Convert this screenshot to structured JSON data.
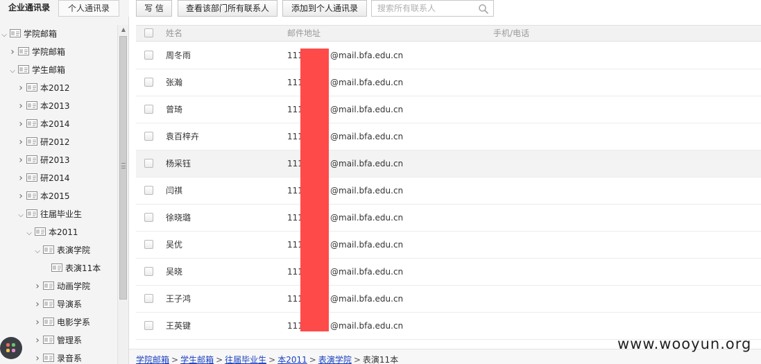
{
  "sidebar": {
    "tabs": [
      {
        "label": "企业通讯录",
        "active": true
      },
      {
        "label": "个人通讯录",
        "active": false
      }
    ],
    "tree": [
      {
        "label": "学院邮箱",
        "level": 0,
        "chevron": "expanded"
      },
      {
        "label": "学院邮箱",
        "level": 1,
        "chevron": "collapsed"
      },
      {
        "label": "学生邮箱",
        "level": 1,
        "chevron": "expanded"
      },
      {
        "label": "本2012",
        "level": 2,
        "chevron": "collapsed"
      },
      {
        "label": "本2013",
        "level": 2,
        "chevron": "collapsed"
      },
      {
        "label": "本2014",
        "level": 2,
        "chevron": "collapsed"
      },
      {
        "label": "研2012",
        "level": 2,
        "chevron": "collapsed"
      },
      {
        "label": "研2013",
        "level": 2,
        "chevron": "collapsed"
      },
      {
        "label": "研2014",
        "level": 2,
        "chevron": "collapsed"
      },
      {
        "label": "本2015",
        "level": 2,
        "chevron": "collapsed"
      },
      {
        "label": "往届毕业生",
        "level": 2,
        "chevron": "expanded"
      },
      {
        "label": "本2011",
        "level": 3,
        "chevron": "expanded"
      },
      {
        "label": "表演学院",
        "level": 4,
        "chevron": "expanded"
      },
      {
        "label": "表演11本",
        "level": 5,
        "chevron": "none"
      },
      {
        "label": "动画学院",
        "level": 4,
        "chevron": "collapsed"
      },
      {
        "label": "导演系",
        "level": 4,
        "chevron": "collapsed"
      },
      {
        "label": "电影学系",
        "level": 4,
        "chevron": "collapsed"
      },
      {
        "label": "管理系",
        "level": 4,
        "chevron": "collapsed"
      },
      {
        "label": "录音系",
        "level": 4,
        "chevron": "collapsed"
      }
    ]
  },
  "toolbar": {
    "write_label": "写 信",
    "view_all_label": "查看该部门所有联系人",
    "add_personal_label": "添加到个人通讯录",
    "search_placeholder": "搜索所有联系人"
  },
  "table": {
    "headers": {
      "name": "姓名",
      "email": "邮件地址",
      "phone": "手机/电话"
    },
    "rows": [
      {
        "name": "周冬雨",
        "email_prefix": "111",
        "email_domain": "@mail.bfa.edu.cn",
        "phone": ""
      },
      {
        "name": "张瀚",
        "email_prefix": "111",
        "email_domain": "@mail.bfa.edu.cn",
        "phone": ""
      },
      {
        "name": "曾琦",
        "email_prefix": "111",
        "email_domain": "@mail.bfa.edu.cn",
        "phone": ""
      },
      {
        "name": "袁百梓卉",
        "email_prefix": "111",
        "email_domain": "@mail.bfa.edu.cn",
        "phone": ""
      },
      {
        "name": "杨采钰",
        "email_prefix": "111",
        "email_domain": "@mail.bfa.edu.cn",
        "phone": "",
        "hover": true
      },
      {
        "name": "闫祺",
        "email_prefix": "111",
        "email_domain": "@mail.bfa.edu.cn",
        "phone": ""
      },
      {
        "name": "徐晓璐",
        "email_prefix": "111",
        "email_domain": "@mail.bfa.edu.cn",
        "phone": ""
      },
      {
        "name": "吴优",
        "email_prefix": "111",
        "email_domain": "@mail.bfa.edu.cn",
        "phone": ""
      },
      {
        "name": "吴晓",
        "email_prefix": "111",
        "email_domain": "@mail.bfa.edu.cn",
        "phone": ""
      },
      {
        "name": "王子鸿",
        "email_prefix": "111",
        "email_domain": "@mail.bfa.edu.cn",
        "phone": ""
      },
      {
        "name": "王英键",
        "email_prefix": "111",
        "email_domain": "@mail.bfa.edu.cn",
        "phone": ""
      }
    ]
  },
  "breadcrumb": {
    "links": [
      "学院邮箱",
      "学生邮箱",
      "往届毕业生",
      "本2011",
      "表演学院"
    ],
    "current": "表演11本",
    "separator": ">"
  },
  "watermark": "www.wooyun.org",
  "colors": {
    "redaction": "#ff4a4a",
    "link": "#1a3fbf",
    "sidebar_bg": "#f4f4f4",
    "hover_row": "#f3f3f3"
  },
  "icons": {
    "tree_node": "contact-card-icon",
    "search": "magnifier-icon",
    "launcher": "app-grid-icon"
  }
}
